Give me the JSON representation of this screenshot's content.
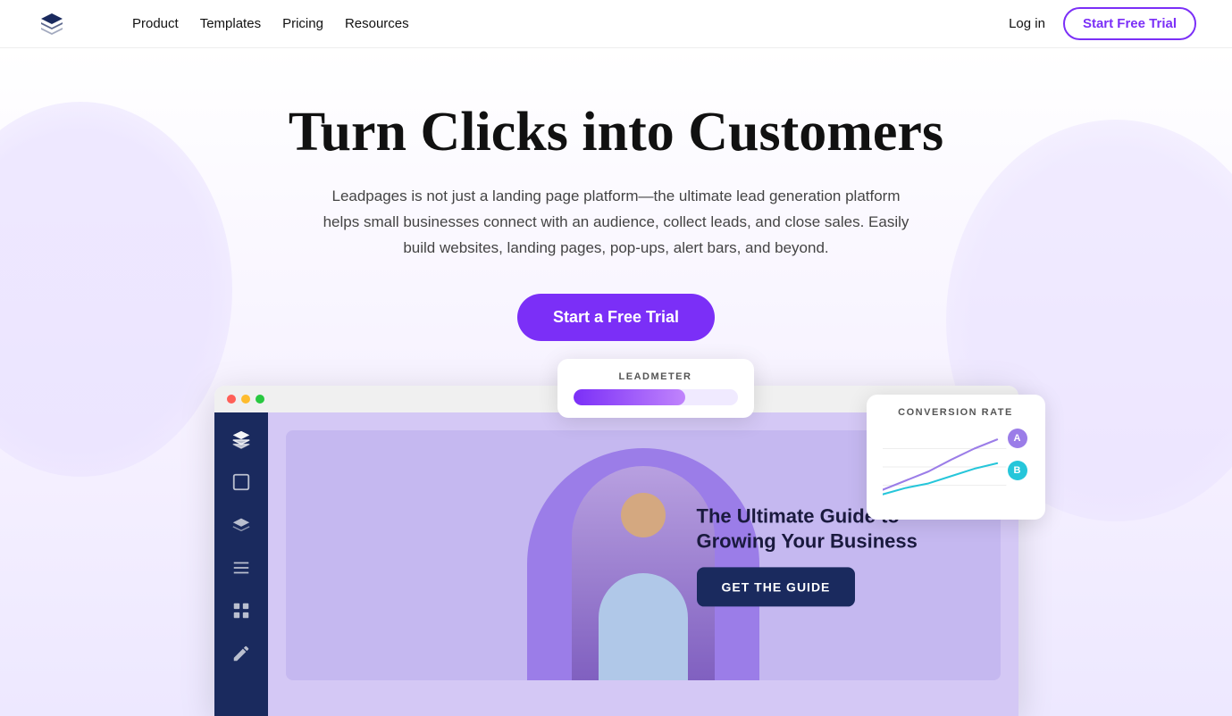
{
  "nav": {
    "links": [
      {
        "id": "product",
        "label": "Product"
      },
      {
        "id": "templates",
        "label": "Templates"
      },
      {
        "id": "pricing",
        "label": "Pricing"
      },
      {
        "id": "resources",
        "label": "Resources"
      }
    ],
    "login_label": "Log in",
    "cta_label": "Start Free Trial"
  },
  "hero": {
    "title": "Turn Clicks into Customers",
    "subtitle": "Leadpages is not just a landing page platform—the ultimate lead generation platform helps small businesses connect with an audience, collect leads, and close sales. Easily build websites, landing pages, pop-ups, alert bars, and beyond.",
    "cta_label": "Start a Free Trial"
  },
  "leadmeter_card": {
    "label": "LEADMETER"
  },
  "conversion_card": {
    "label": "CONVERSION RATE",
    "dot_a": "A",
    "dot_b": "B"
  },
  "builder_page": {
    "title": "The Ultimate Guide to Growing Your Business",
    "cta_label": "GET THE GUIDE"
  },
  "colors": {
    "purple": "#7b2ff7",
    "navy": "#1a2a5e",
    "light_purple_bg": "#f5f0ff"
  }
}
